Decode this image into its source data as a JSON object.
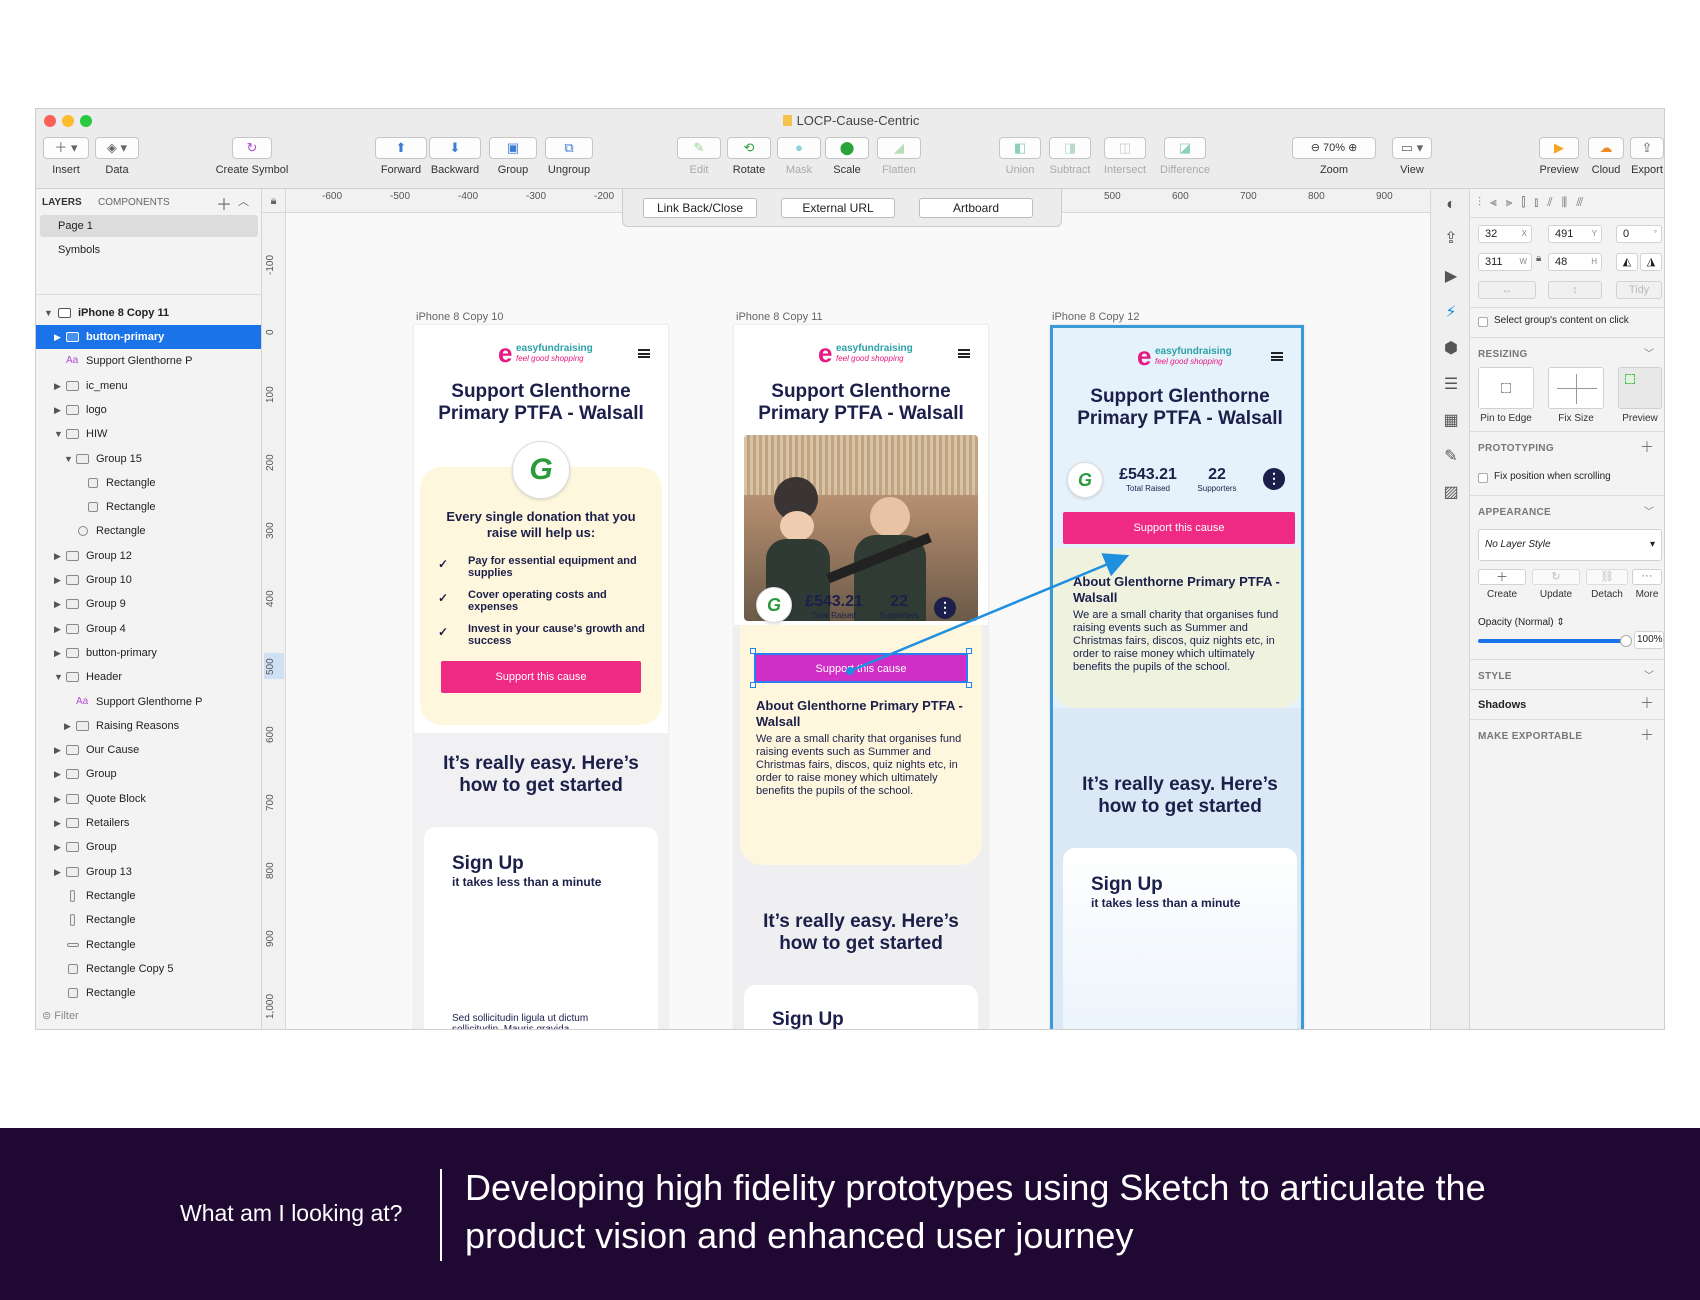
{
  "window": {
    "title": "LOCP-Cause-Centric"
  },
  "toolbar": {
    "insert": "Insert",
    "data": "Data",
    "create_symbol": "Create Symbol",
    "forward": "Forward",
    "backward": "Backward",
    "group": "Group",
    "ungroup": "Ungroup",
    "edit": "Edit",
    "rotate": "Rotate",
    "mask": "Mask",
    "scale": "Scale",
    "flatten": "Flatten",
    "union": "Union",
    "subtract": "Subtract",
    "intersect": "Intersect",
    "difference": "Difference",
    "zoom_value": "70%",
    "zoom": "Zoom",
    "view": "View",
    "preview": "Preview",
    "cloud": "Cloud",
    "export": "Export"
  },
  "layers_panel": {
    "tab_layers": "LAYERS",
    "tab_components": "COMPONENTS",
    "pages": [
      "Page 1",
      "Symbols"
    ],
    "artboard": "iPhone 8 Copy 11",
    "items": [
      {
        "label": "button-primary",
        "indent": 1,
        "kind": "folder",
        "arrow": "▶",
        "selected": true
      },
      {
        "label": "Support Glenthorne P",
        "indent": 1,
        "kind": "text",
        "arrow": ""
      },
      {
        "label": "ic_menu",
        "indent": 1,
        "kind": "folder",
        "arrow": "▶"
      },
      {
        "label": "logo",
        "indent": 1,
        "kind": "folder",
        "arrow": "▶"
      },
      {
        "label": "HIW",
        "indent": 1,
        "kind": "folder",
        "arrow": "▼"
      },
      {
        "label": "Group 15",
        "indent": 2,
        "kind": "folder",
        "arrow": "▼"
      },
      {
        "label": "Rectangle",
        "indent": 3,
        "kind": "rect",
        "arrow": ""
      },
      {
        "label": "Rectangle",
        "indent": 3,
        "kind": "rect",
        "arrow": ""
      },
      {
        "label": "Rectangle",
        "indent": 2,
        "kind": "circle",
        "arrow": ""
      },
      {
        "label": "Group 12",
        "indent": 1,
        "kind": "folder",
        "arrow": "▶"
      },
      {
        "label": "Group 10",
        "indent": 1,
        "kind": "folder",
        "arrow": "▶"
      },
      {
        "label": "Group 9",
        "indent": 1,
        "kind": "folder",
        "arrow": "▶"
      },
      {
        "label": "Group 4",
        "indent": 1,
        "kind": "folder",
        "arrow": "▶"
      },
      {
        "label": "button-primary",
        "indent": 1,
        "kind": "folder",
        "arrow": "▶"
      },
      {
        "label": "Header",
        "indent": 1,
        "kind": "folder",
        "arrow": "▼"
      },
      {
        "label": "Support Glenthorne P",
        "indent": 2,
        "kind": "text",
        "arrow": ""
      },
      {
        "label": "Raising Reasons",
        "indent": 2,
        "kind": "folder",
        "arrow": "▶"
      },
      {
        "label": "Our Cause",
        "indent": 1,
        "kind": "folder",
        "arrow": "▶"
      },
      {
        "label": "Group",
        "indent": 1,
        "kind": "folder",
        "arrow": "▶"
      },
      {
        "label": "Quote Block",
        "indent": 1,
        "kind": "folder",
        "arrow": "▶"
      },
      {
        "label": "Retailers",
        "indent": 1,
        "kind": "folder",
        "arrow": "▶"
      },
      {
        "label": "Group",
        "indent": 1,
        "kind": "folder",
        "arrow": "▶"
      },
      {
        "label": "Group 13",
        "indent": 1,
        "kind": "folder",
        "arrow": "▶"
      },
      {
        "label": "Rectangle",
        "indent": 1,
        "kind": "vrect",
        "arrow": ""
      },
      {
        "label": "Rectangle",
        "indent": 1,
        "kind": "vrect",
        "arrow": ""
      },
      {
        "label": "Rectangle",
        "indent": 1,
        "kind": "hline",
        "arrow": ""
      },
      {
        "label": "Rectangle Copy 5",
        "indent": 1,
        "kind": "rect",
        "arrow": ""
      },
      {
        "label": "Rectangle",
        "indent": 1,
        "kind": "rect",
        "arrow": ""
      }
    ],
    "filter": "Filter"
  },
  "rulers": {
    "h": [
      "-600",
      "-500",
      "-400",
      "-300",
      "-200",
      "500",
      "600",
      "700",
      "800",
      "900"
    ],
    "v": [
      "-100",
      "0",
      "100",
      "200",
      "300",
      "400",
      "500",
      "600",
      "700",
      "800",
      "900",
      "1,000"
    ]
  },
  "prototype_bar": {
    "link_back": "Link Back/Close",
    "external_url": "External URL",
    "artboard": "Artboard"
  },
  "artboards": {
    "titles": [
      "iPhone 8 Copy 10",
      "iPhone 8 Copy 11",
      "iPhone 8 Copy 12"
    ],
    "logo_e": "e",
    "logo_name": "easyfundraising",
    "logo_tag": "feel good shopping",
    "cause_title": "Support Glenthorne Primary PTFA - Walsall",
    "badge_glyph": "G",
    "help_heading": "Every single donation that you raise will help us:",
    "check_mark": "✓",
    "help_items": [
      "Pay for essential equipment and supplies",
      "Cover operating costs and expenses",
      "Invest in your cause's growth and success"
    ],
    "cta": "Support this cause",
    "easy_heading": "It’s really easy. Here’s how to get started",
    "signup_title": "Sign Up",
    "signup_sub": "it takes less than a minute",
    "lorem": "Sed sollicitudin ligula ut dictum sollicitudin. Mauris gravida consectetur est, quis dapibus nisi",
    "total_raised_value": "£543.21",
    "total_raised_label": "Total Raised",
    "supporters_value": "22",
    "supporters_label": "Supporters",
    "dots": "⋮",
    "about_title": "About Glenthorne Primary PTFA - Walsall",
    "about_body": "We are a small charity that organises fund raising events such as Summer and Christmas fairs, discos, quiz nights etc, in order to raise money which ultimately benefits the pupils of the school.",
    "about_body_short": "We are a small charity that organises fund raising events such as Summer and Christmas fairs, discos, quiz nights etc, in order to raise money which ultimately benefits the pupils of the school."
  },
  "inspector": {
    "x": "32",
    "x_unit": "X",
    "y": "491",
    "y_unit": "Y",
    "rot": "0",
    "rot_unit": "°",
    "w": "311",
    "w_unit": "W",
    "h": "48",
    "h_unit": "H",
    "tidy": "Tidy",
    "select_group": "Select group's content on click",
    "resizing": "RESIZING",
    "pin_to_edge": "Pin to Edge",
    "fix_size": "Fix Size",
    "preview": "Preview",
    "prototyping": "PROTOTYPING",
    "fix_position": "Fix position when scrolling",
    "appearance": "APPEARANCE",
    "layer_style": "No Layer Style",
    "create": "Create",
    "update": "Update",
    "detach": "Detach",
    "more": "More",
    "opacity_label": "Opacity (Normal)",
    "opacity_value": "100%",
    "style": "STYLE",
    "shadows": "Shadows",
    "make_exportable": "MAKE EXPORTABLE"
  },
  "caption": {
    "question": "What am I looking at?",
    "statement": "Developing high fidelity prototypes using Sketch to articulate the product vision and enhanced user journey"
  }
}
